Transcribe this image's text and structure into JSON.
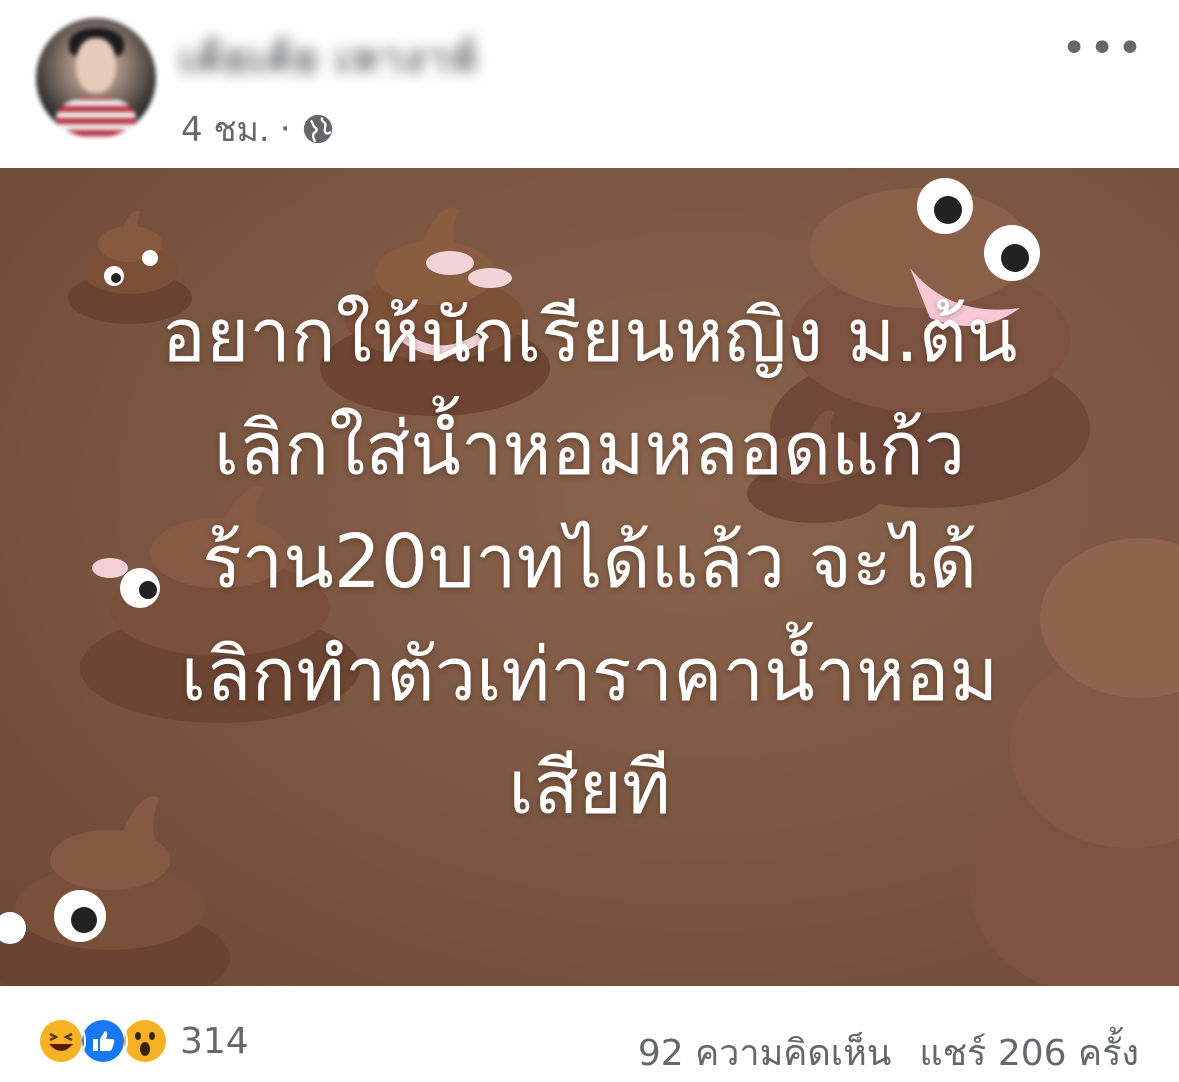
{
  "post": {
    "author_name": "เค้ยเค้ย เหางาห์",
    "time": "4 ชม.",
    "separator": "·",
    "privacy_icon": "globe-icon",
    "more_label": "•••"
  },
  "image": {
    "lines": [
      "อยากให้นักเรียนหญิง ม.ต้น",
      "เลิกใส่น้ำหอมหลอดแก้ว",
      "ร้าน20บาทได้แล้ว จะได้",
      "เลิกทำตัวเท่าราคาน้ำหอม",
      "เสียที"
    ],
    "background_color": "#7a5540",
    "decoration_icon": "poop-emoji-icon"
  },
  "footer": {
    "reactions": [
      "haha-icon",
      "like-icon",
      "wow-icon"
    ],
    "reaction_count": "314",
    "comments": "92 ความคิดเห็น",
    "shares": "แชร์ 206 ครั้ง"
  },
  "colors": {
    "secondary_text": "#65676b",
    "like_blue": "#1877f2",
    "emoji_yellow": "#f7b125"
  }
}
